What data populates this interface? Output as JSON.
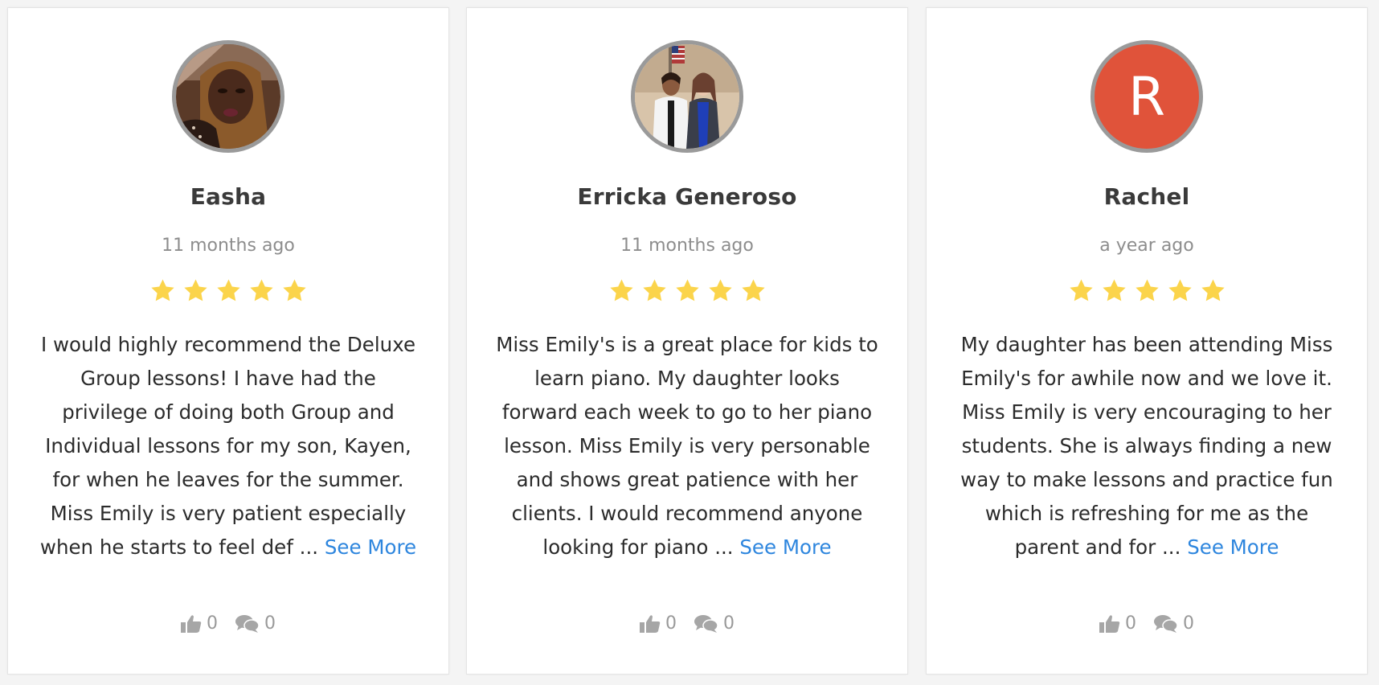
{
  "reviews": [
    {
      "name": "Easha",
      "time": "11 months ago",
      "rating": 5,
      "avatar": {
        "type": "photo",
        "icon": "user-photo"
      },
      "text": "I would highly recommend the Deluxe Group lessons! I have had the privilege of doing both Group and Individual lessons for my son, Kayen, for when he leaves for the summer. Miss Emily is very patient especially when he starts to feel def ...",
      "see_more": "See More",
      "likes": "0",
      "comments": "0"
    },
    {
      "name": "Erricka Generoso",
      "time": "11 months ago",
      "rating": 5,
      "avatar": {
        "type": "photo",
        "icon": "user-photo"
      },
      "text": "Miss Emily's is a great place for kids to learn piano. My daughter looks forward each week to go to her piano lesson. Miss Emily is very personable and shows great patience with her clients. I would recommend anyone looking for piano ...",
      "see_more": "See More",
      "likes": "0",
      "comments": "0"
    },
    {
      "name": "Rachel",
      "time": "a year ago",
      "rating": 5,
      "avatar": {
        "type": "letter",
        "letter": "R",
        "color": "#e0533a"
      },
      "text": "My daughter has been attending Miss Emily's for awhile now and we love it. Miss Emily is very encouraging to her students. She is always finding a new way to make lessons and practice fun which is refreshing for me as the parent and for ...",
      "see_more": "See More",
      "likes": "0",
      "comments": "0"
    }
  ],
  "colors": {
    "star": "#fbd44b",
    "link": "#2e86de",
    "avatar_border": "#9a9a9a",
    "icon": "#a6a6a6"
  }
}
